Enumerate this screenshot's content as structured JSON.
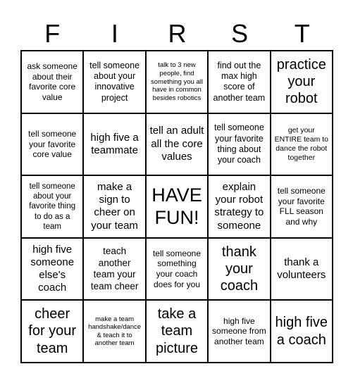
{
  "header": {
    "letters": [
      "F",
      "I",
      "R",
      "S",
      "T"
    ]
  },
  "cells": [
    {
      "text": "ask someone about their favorite core value",
      "size": 12
    },
    {
      "text": "tell someone about your innovative project",
      "size": 12.5
    },
    {
      "text": "talk to 3 new people, find something you all have in common besides robotics",
      "size": 9.5
    },
    {
      "text": "find out the max high score of another team",
      "size": 12.5
    },
    {
      "text": "practice your robot",
      "size": 20
    },
    {
      "text": "tell someone your favorite core value",
      "size": 12
    },
    {
      "text": "high five a teammate",
      "size": 15
    },
    {
      "text": "tell an adult all the core values",
      "size": 15
    },
    {
      "text": "tell someone your favorite thing about your coach",
      "size": 12.5
    },
    {
      "text": "get your ENTIRE team to dance the robot together",
      "size": 10.5
    },
    {
      "text": "tell someone about your favorite thing to do as a team",
      "size": 11.5
    },
    {
      "text": "make a sign to cheer on your team",
      "size": 15
    },
    {
      "text": "HAVE FUN!",
      "size": 27
    },
    {
      "text": "explain your robot strategy to someone",
      "size": 15
    },
    {
      "text": "tell someone your favorite FLL season and why",
      "size": 12
    },
    {
      "text": "high five someone else's coach",
      "size": 15
    },
    {
      "text": "teach another team your team cheer",
      "size": 13.5
    },
    {
      "text": "tell someone something your coach does for you",
      "size": 12
    },
    {
      "text": "thank your coach",
      "size": 20
    },
    {
      "text": "thank a volunteers",
      "size": 15
    },
    {
      "text": "cheer for your team",
      "size": 20
    },
    {
      "text": "make a team handshake/dance & teach it to another team",
      "size": 9.5
    },
    {
      "text": "take a team picture",
      "size": 20
    },
    {
      "text": "high five someone from another team",
      "size": 12
    },
    {
      "text": "high five a coach",
      "size": 20
    }
  ]
}
